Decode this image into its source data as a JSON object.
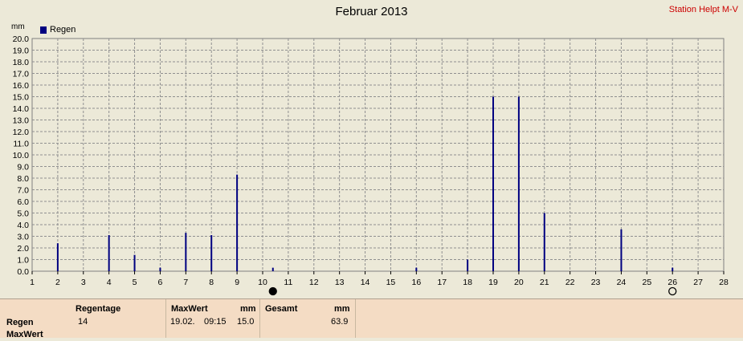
{
  "header": {
    "title": "Februar 2013",
    "station": "Station Helpt M-V",
    "ylabel": "mm",
    "legend": "Regen"
  },
  "chart_data": {
    "type": "bar",
    "title": "Februar 2013",
    "ylabel": "mm",
    "xlim": [
      1,
      28
    ],
    "ylim": [
      0,
      20
    ],
    "y_step": 1.0,
    "grid": true,
    "legend_position": "top-left",
    "series": [
      {
        "name": "Regen",
        "color": "#000080",
        "points": [
          {
            "x": 2,
            "y": 2.4
          },
          {
            "x": 4,
            "y": 3.1
          },
          {
            "x": 5,
            "y": 1.4
          },
          {
            "x": 6,
            "y": 0.3
          },
          {
            "x": 7,
            "y": 3.3
          },
          {
            "x": 8,
            "y": 3.1
          },
          {
            "x": 9,
            "y": 8.3
          },
          {
            "x": 10.4,
            "y": 0.3
          },
          {
            "x": 16,
            "y": 0.3
          },
          {
            "x": 18,
            "y": 1.0
          },
          {
            "x": 19,
            "y": 15.0
          },
          {
            "x": 20,
            "y": 15.0
          },
          {
            "x": 21,
            "y": 5.0
          },
          {
            "x": 24,
            "y": 3.6
          },
          {
            "x": 26,
            "y": 0.3
          }
        ]
      }
    ],
    "markers": [
      {
        "x": 10.4,
        "style": "filled-circle"
      },
      {
        "x": 26,
        "style": "open-circle"
      }
    ]
  },
  "info": {
    "row_labels": [
      "Regen",
      "MaxWert"
    ],
    "regentage": {
      "header": "Regentage",
      "value": "14"
    },
    "maxwert": {
      "header": "MaxWert",
      "unit": "mm",
      "date": "19.02.",
      "time": "09:15",
      "value": "15.0"
    },
    "gesamt": {
      "header": "Gesamt",
      "unit": "mm",
      "value": "63.9"
    }
  }
}
